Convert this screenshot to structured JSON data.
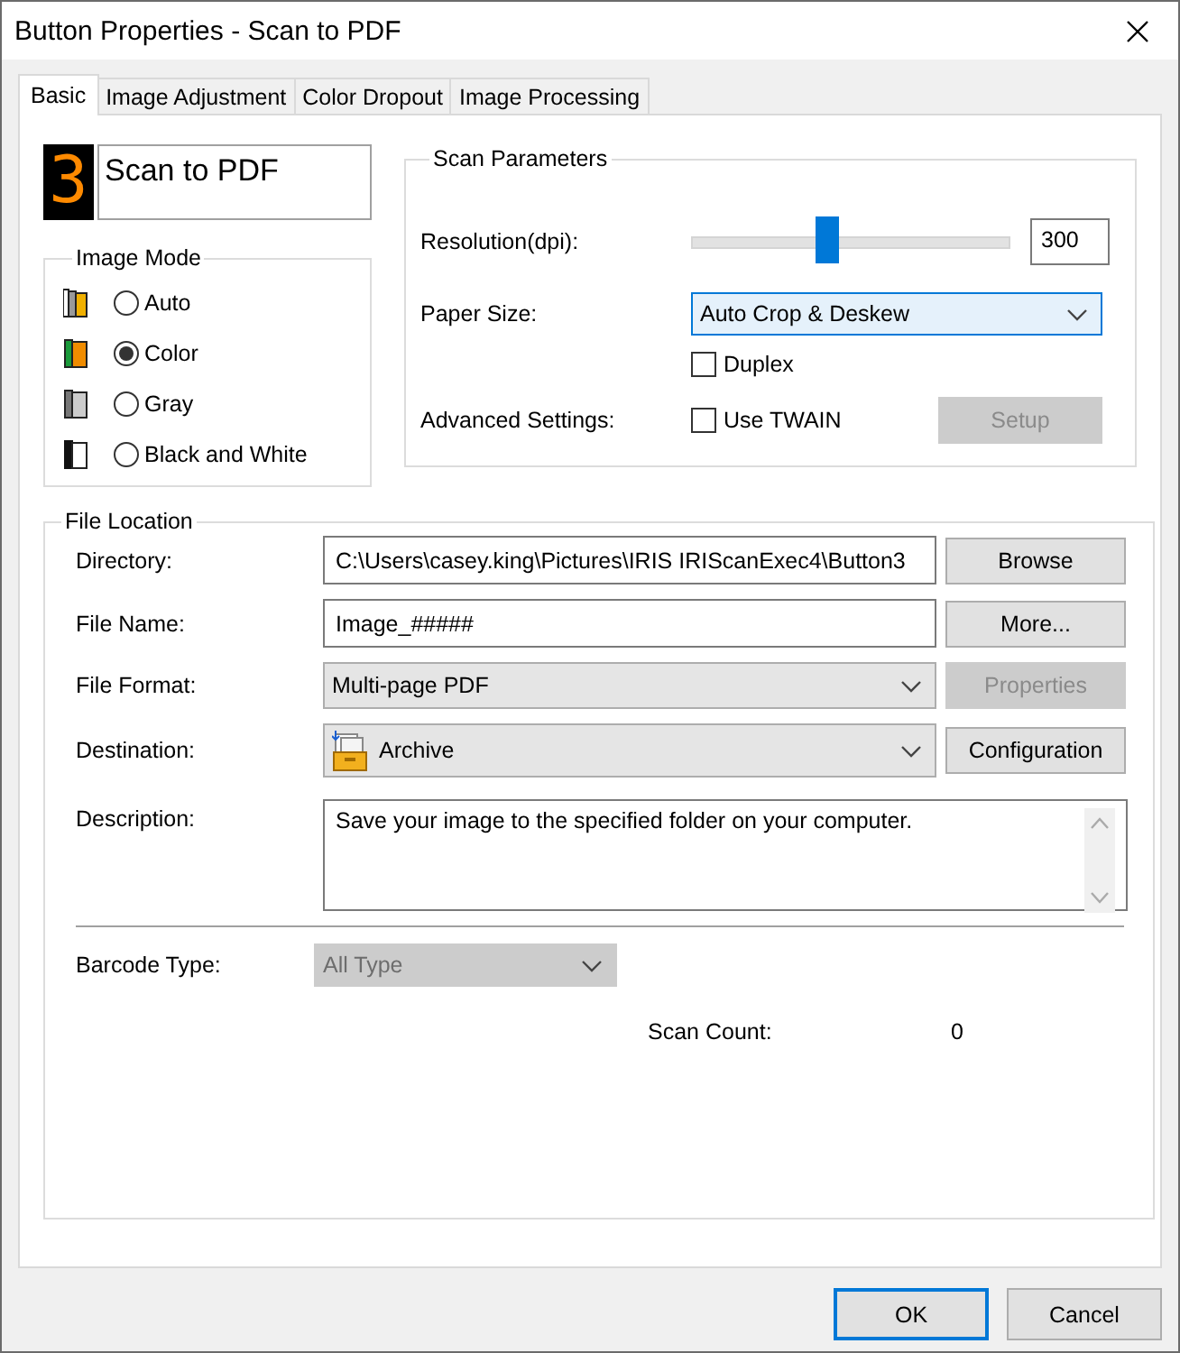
{
  "window": {
    "title": "Button Properties - Scan to PDF"
  },
  "tabs": [
    {
      "label": "Basic",
      "selected": true
    },
    {
      "label": "Image Adjustment",
      "selected": false
    },
    {
      "label": "Color Dropout",
      "selected": false
    },
    {
      "label": "Image Processing",
      "selected": false
    }
  ],
  "button_name": {
    "digit": "3",
    "name": "Scan to PDF"
  },
  "image_mode": {
    "title": "Image Mode",
    "options": [
      {
        "kind": "auto",
        "label": "Auto",
        "selected": false
      },
      {
        "kind": "color",
        "label": "Color",
        "selected": true
      },
      {
        "kind": "gray",
        "label": "Gray",
        "selected": false
      },
      {
        "kind": "bw",
        "label": "Black and White",
        "selected": false
      }
    ]
  },
  "scan_parameters": {
    "title": "Scan Parameters",
    "resolution": {
      "label": "Resolution(dpi):",
      "level": 0.43,
      "value": "300"
    },
    "paper_size": {
      "label": "Paper Size:",
      "value": "Auto Crop & Deskew"
    },
    "duplex": {
      "label": "Duplex",
      "checked": false
    },
    "advanced_settings": {
      "label": "Advanced Settings:"
    },
    "use_twain": {
      "label": "Use TWAIN",
      "checked": false
    },
    "setup": {
      "label": "Setup",
      "disabled": true
    }
  },
  "file_location": {
    "title": "File Location",
    "rows": [
      {
        "kind": "text",
        "label": "Directory:",
        "value": "C:\\Users\\casey.king\\Pictures\\IRIS IRIScanExec4\\Button3",
        "button": {
          "label": "Browse",
          "disabled": false
        }
      },
      {
        "kind": "text",
        "label": "File Name:",
        "value": "Image_#####",
        "button": {
          "label": "More...",
          "disabled": false
        }
      },
      {
        "kind": "select",
        "label": "File Format:",
        "value": "Multi-page PDF",
        "button": {
          "label": "Properties",
          "disabled": true
        }
      },
      {
        "kind": "destination",
        "label": "Destination:",
        "value": "Archive",
        "button": {
          "label": "Configuration",
          "disabled": false
        }
      },
      {
        "kind": "textarea",
        "label": "Description:",
        "value": "Save your image to the specified folder on your computer."
      }
    ],
    "barcode_type": {
      "label": "Barcode Type:",
      "value": "All Type",
      "disabled": true
    },
    "scan_count": {
      "label": "Scan Count:",
      "value": "0"
    }
  },
  "buttons": [
    {
      "label": "OK",
      "default": true
    },
    {
      "label": "Cancel",
      "default": false
    }
  ]
}
